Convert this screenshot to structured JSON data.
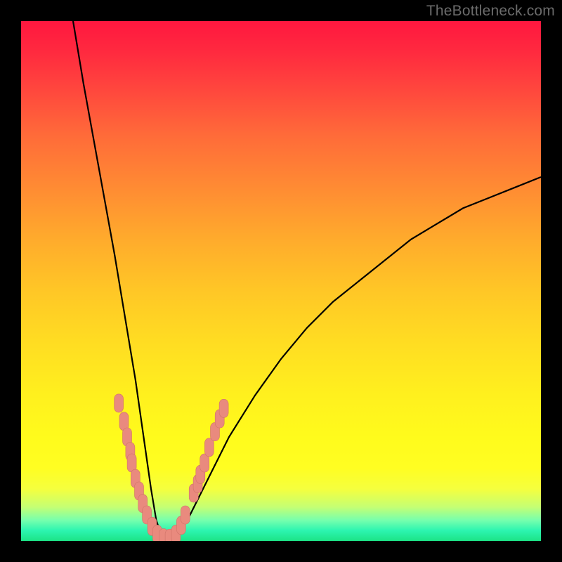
{
  "watermark": "TheBottleneck.com",
  "colors": {
    "frame": "#000000",
    "curve": "#000000",
    "marker_fill": "#e98a7e",
    "marker_stroke": "#d07368",
    "gradient_stops": [
      "#ff173f",
      "#1de386"
    ]
  },
  "chart_data": {
    "type": "line",
    "title": "",
    "xlabel": "",
    "ylabel": "",
    "xlim": [
      0,
      100
    ],
    "ylim": [
      0,
      100
    ],
    "gradient": "vertical red→yellow→green (top→bottom)",
    "series": [
      {
        "name": "bottleneck-curve",
        "description": "V-shaped curve; y≈100 at x≈10, drops to y≈0 near x≈26, flat ≈0 to x≈30, rises with diminishing slope toward y≈70 at x=100",
        "x": [
          10,
          12,
          14,
          16,
          18,
          20,
          21,
          22,
          23,
          24,
          25,
          26,
          27,
          28,
          29,
          30,
          32,
          35,
          40,
          45,
          50,
          55,
          60,
          65,
          70,
          75,
          80,
          85,
          90,
          95,
          100
        ],
        "y": [
          100,
          88,
          77,
          66,
          55,
          43,
          37,
          31,
          24,
          17,
          10,
          4,
          1,
          0,
          0,
          1,
          4,
          10,
          20,
          28,
          35,
          41,
          46,
          50,
          54,
          58,
          61,
          64,
          66,
          68,
          70
        ]
      }
    ],
    "markers": {
      "name": "highlighted-points",
      "shape": "rounded-rect",
      "points": [
        {
          "x": 18.8,
          "y": 26.5
        },
        {
          "x": 19.8,
          "y": 23.0
        },
        {
          "x": 20.4,
          "y": 20.0
        },
        {
          "x": 21.0,
          "y": 17.2
        },
        {
          "x": 21.3,
          "y": 15.0
        },
        {
          "x": 22.0,
          "y": 12.0
        },
        {
          "x": 22.7,
          "y": 9.6
        },
        {
          "x": 23.4,
          "y": 7.2
        },
        {
          "x": 24.2,
          "y": 5.0
        },
        {
          "x": 25.2,
          "y": 2.8
        },
        {
          "x": 26.2,
          "y": 1.3
        },
        {
          "x": 27.4,
          "y": 0.6
        },
        {
          "x": 28.6,
          "y": 0.5
        },
        {
          "x": 29.8,
          "y": 1.3
        },
        {
          "x": 30.8,
          "y": 3.0
        },
        {
          "x": 31.6,
          "y": 5.0
        },
        {
          "x": 33.2,
          "y": 9.2
        },
        {
          "x": 34.0,
          "y": 11.0
        },
        {
          "x": 34.5,
          "y": 12.8
        },
        {
          "x": 35.3,
          "y": 15.0
        },
        {
          "x": 36.2,
          "y": 18.0
        },
        {
          "x": 37.3,
          "y": 21.0
        },
        {
          "x": 38.2,
          "y": 23.5
        },
        {
          "x": 39.0,
          "y": 25.5
        }
      ]
    }
  }
}
